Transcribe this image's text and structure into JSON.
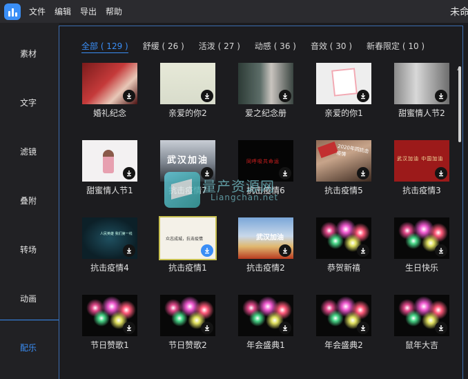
{
  "app": {
    "logo_icon": "app-logo-icon",
    "window_title": "未命"
  },
  "menu": [
    {
      "label": "文件"
    },
    {
      "label": "编辑"
    },
    {
      "label": "导出"
    },
    {
      "label": "帮助"
    }
  ],
  "sidebar": {
    "items": [
      {
        "label": "素材"
      },
      {
        "label": "文字"
      },
      {
        "label": "滤镜"
      },
      {
        "label": "叠附"
      },
      {
        "label": "转场"
      },
      {
        "label": "动画"
      },
      {
        "label": "配乐"
      }
    ],
    "active_index": 6
  },
  "tabs": [
    {
      "label": "全部 ( 129 )",
      "active": true
    },
    {
      "label": "舒缓 ( 26 )"
    },
    {
      "label": "活泼 ( 27 )"
    },
    {
      "label": "动感 ( 36 )"
    },
    {
      "label": "音效 ( 30 )"
    },
    {
      "label": "新春限定 ( 10 )"
    }
  ],
  "items": [
    {
      "label": "婚礼纪念",
      "style": "wedding"
    },
    {
      "label": "亲爱的你2",
      "style": "cream"
    },
    {
      "label": "爱之纪念册",
      "style": "couple"
    },
    {
      "label": "亲爱的你1",
      "style": "pinkframe"
    },
    {
      "label": "甜蜜情人节2",
      "style": "portrait"
    },
    {
      "label": "甜蜜情人节1",
      "style": "sketch"
    },
    {
      "label": "抗击疫情7",
      "style": "city",
      "thumb_text": "武汉加油"
    },
    {
      "label": "抗击疫情6",
      "style": "black",
      "thumb_text": "同呼吸共命运"
    },
    {
      "label": "抗击疫情5",
      "style": "ruins",
      "thumb_text": "2020年同抗击疫情"
    },
    {
      "label": "抗击疫情3",
      "style": "red",
      "thumb_text": "武汉加油  中国加油"
    },
    {
      "label": "抗击疫情4",
      "style": "teal",
      "thumb_text": "人民英雄 我们第一线"
    },
    {
      "label": "抗击疫情1",
      "style": "paper",
      "thumb_text": "众志成城，抗击疫情",
      "selected": true
    },
    {
      "label": "抗击疫情2",
      "style": "tower",
      "thumb_text": "武汉加油"
    },
    {
      "label": "恭贺新禧",
      "style": "fire"
    },
    {
      "label": "生日快乐",
      "style": "fire"
    },
    {
      "label": "节日赞歌1",
      "style": "fire"
    },
    {
      "label": "节日赞歌2",
      "style": "fire"
    },
    {
      "label": "年会盛典1",
      "style": "fire"
    },
    {
      "label": "年会盛典2",
      "style": "fire"
    },
    {
      "label": "鼠年大吉",
      "style": "fire"
    }
  ],
  "watermark": {
    "title": "量产资源网",
    "subtitle": "Liangchan.net"
  },
  "colors": {
    "accent": "#3a8ef6",
    "panel_border": "#3d6fb3",
    "selected_outline": "#c8c050"
  }
}
